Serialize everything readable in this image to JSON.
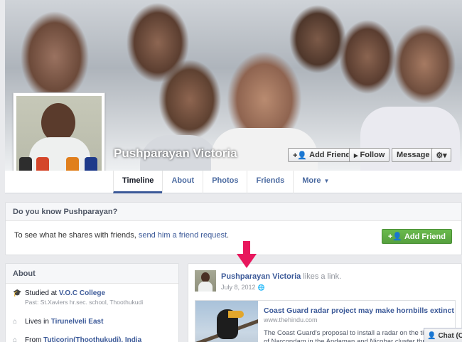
{
  "profile": {
    "name": "Pushparayan Victoria"
  },
  "cover_actions": {
    "add_friend": "Add Friend",
    "follow": "Follow",
    "message": "Message"
  },
  "nav": {
    "tabs": [
      {
        "label": "Timeline",
        "active": true
      },
      {
        "label": "About"
      },
      {
        "label": "Photos"
      },
      {
        "label": "Friends"
      },
      {
        "label": "More"
      }
    ]
  },
  "know_box": {
    "heading": "Do you know Pushparayan?",
    "text_prefix": "To see what he shares with friends, ",
    "link_text": "send him a friend request",
    "text_suffix": ".",
    "button_label": "Add Friend"
  },
  "about": {
    "heading": "About",
    "items": [
      {
        "prefix": "Studied at ",
        "link": "V.O.C College",
        "sub": "Past: St.Xaviers hr.sec. school, Thoothukudi"
      },
      {
        "prefix": "Lives in ",
        "link": "Tirunelveli East"
      },
      {
        "prefix": "From ",
        "link": "Tuticorin(Thoothukudi), India"
      }
    ]
  },
  "post": {
    "author": "Pushparayan Victoria",
    "action": " likes a link.",
    "date": "July 8, 2012",
    "link": {
      "title": "Coast Guard radar project may make hornbills extinct",
      "url": "www.thehindu.com",
      "description": "The Coast Guard's proposal to install a radar on the tiny island of Narcondam in the Andaman and Nicobar cluster threatens to wipe"
    }
  },
  "chat": {
    "label": "Chat (Of"
  },
  "colors": {
    "link": "#3b5998",
    "green_button": "#5ba843",
    "arrow": "#e8175d"
  }
}
